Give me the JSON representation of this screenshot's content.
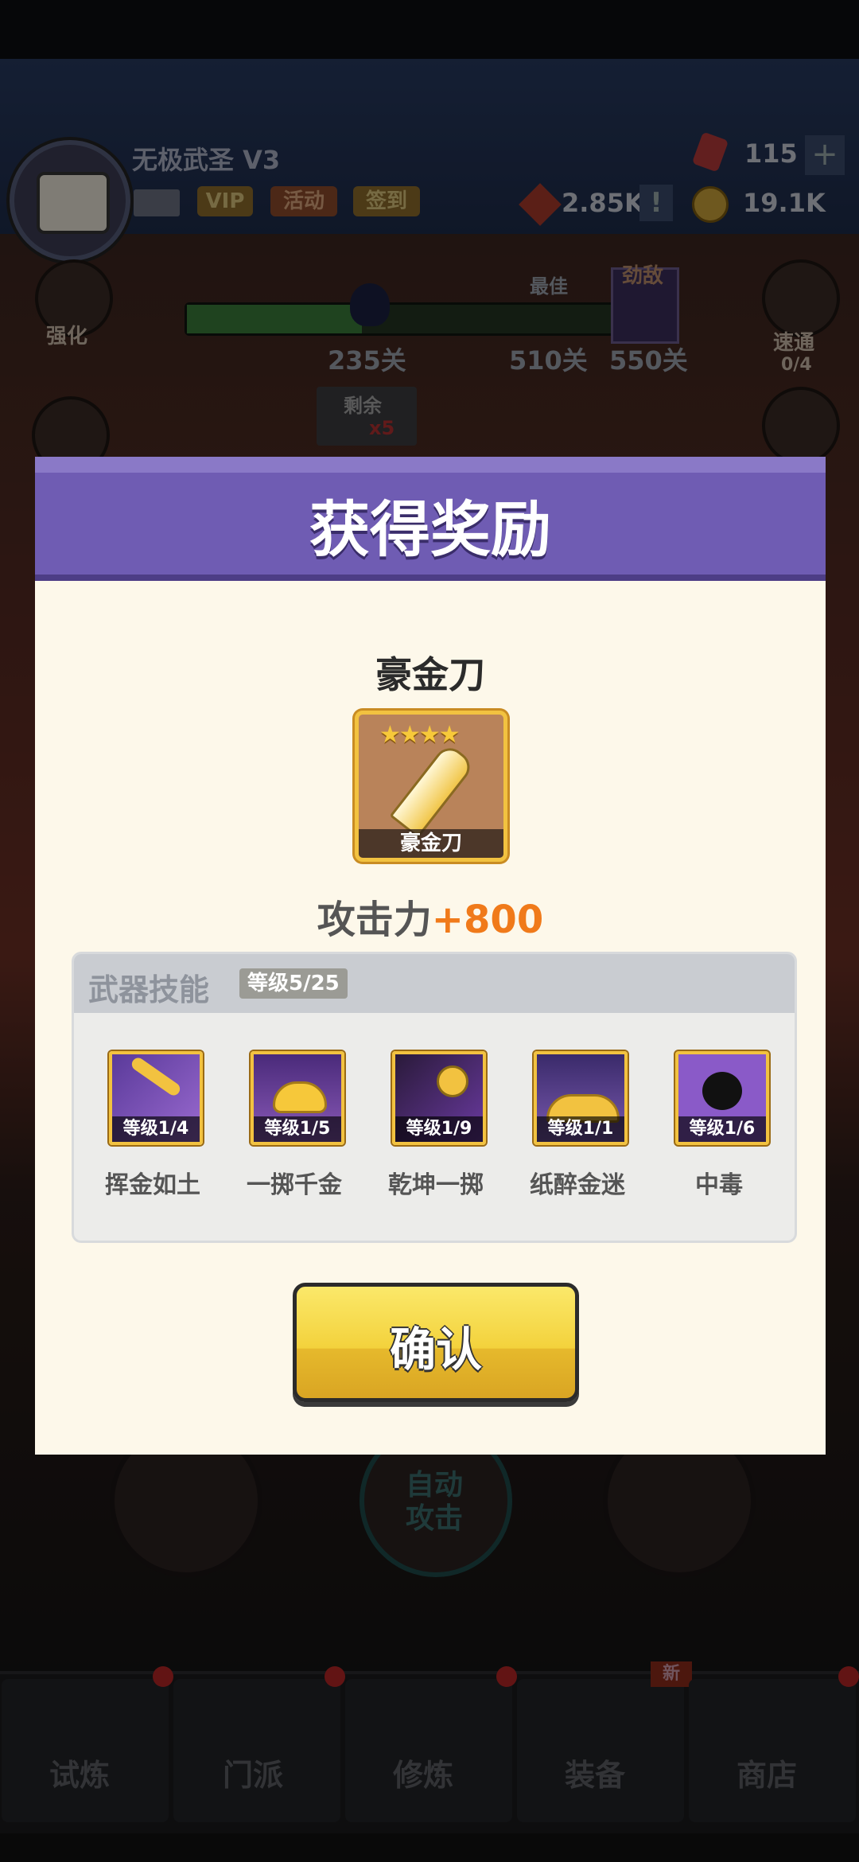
{
  "background": {
    "player_name": "无极武圣",
    "vip_level": "V3",
    "chips": [
      "VIP",
      "活动",
      "签到"
    ],
    "gems": "115",
    "power": "2.85K",
    "coins": "19.1K",
    "stages": {
      "current": "235关",
      "best_label": "最佳",
      "best": "510关",
      "boss_label": "劲敌",
      "boss": "550关"
    },
    "remaining_label": "剩余",
    "remaining_count": "x5",
    "left_buttons": [
      "强化"
    ],
    "right_buttons": {
      "label": "速通",
      "count": "0/4"
    },
    "controls": {
      "auto_attack": "自动攻击"
    },
    "nav": [
      {
        "label": "试炼",
        "dot": true
      },
      {
        "label": "门派",
        "dot": true
      },
      {
        "label": "修炼",
        "dot": true
      },
      {
        "label": "装备",
        "badge": "新"
      },
      {
        "label": "商店",
        "dot": true
      }
    ]
  },
  "modal": {
    "title": "获得奖励",
    "item": {
      "name": "豪金刀",
      "card_label": "豪金刀",
      "stars": 4,
      "attack_label": "攻击力",
      "attack_value": "+800"
    },
    "skills_section": {
      "title": "武器技能",
      "level": "等级5/25",
      "skills": [
        {
          "name": "挥金如土",
          "level": "等级1/4",
          "icon": "golden-sword-icon"
        },
        {
          "name": "一掷千金",
          "level": "等级1/5",
          "icon": "gold-ingot-icon"
        },
        {
          "name": "乾坤一掷",
          "level": "等级1/9",
          "icon": "coin-toss-icon"
        },
        {
          "name": "纸醉金迷",
          "level": "等级1/1",
          "icon": "gold-pile-icon"
        },
        {
          "name": "中毒",
          "level": "等级1/6",
          "icon": "poison-blob-icon"
        }
      ]
    },
    "confirm_label": "确认"
  },
  "colors": {
    "header_purple": "#6f5cb3",
    "attack_orange": "#f07a1a",
    "frame_gold": "#f2c240",
    "button_yellow": "#f3d23c"
  }
}
